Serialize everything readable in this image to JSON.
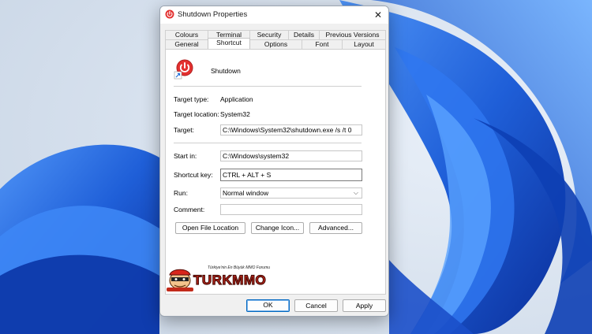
{
  "window": {
    "title": "Shutdown Properties",
    "close_glyph": "✕"
  },
  "tabs_row1": [
    "Colours",
    "Terminal",
    "Security",
    "Details",
    "Previous Versions"
  ],
  "tabs_row2": [
    "General",
    "Shortcut",
    "Options",
    "Font",
    "Layout"
  ],
  "active_tab": "Shortcut",
  "shortcut": {
    "name": "Shutdown",
    "target_type_label": "Target type:",
    "target_type_value": "Application",
    "target_location_label": "Target location:",
    "target_location_value": "System32",
    "target_label": "Target:",
    "target_value": "C:\\Windows\\System32\\shutdown.exe /s /t 0",
    "start_in_label": "Start in:",
    "start_in_value": "C:\\Windows\\system32",
    "shortcut_key_label": "Shortcut key:",
    "shortcut_key_value": "CTRL + ALT + S",
    "run_label": "Run:",
    "run_value": "Normal window",
    "comment_label": "Comment:",
    "comment_value": ""
  },
  "buttons": {
    "open_file_location": "Open File Location",
    "change_icon": "Change Icon...",
    "advanced": "Advanced...",
    "ok": "OK",
    "cancel": "Cancel",
    "apply": "Apply"
  },
  "watermark": {
    "tagline": "Türkiye'nin En Büyük MMO Forumu",
    "brand": "TURKMMO"
  },
  "colors": {
    "accent": "#0067c0",
    "wallpaper_bg": "#dbe6f2",
    "wallpaper_blue": "#1e5fd8",
    "shutdown_red": "#e3302f"
  },
  "icons": {
    "app": "power-shutdown-icon",
    "close": "close-icon",
    "dropdown": "chevron-down-icon"
  }
}
